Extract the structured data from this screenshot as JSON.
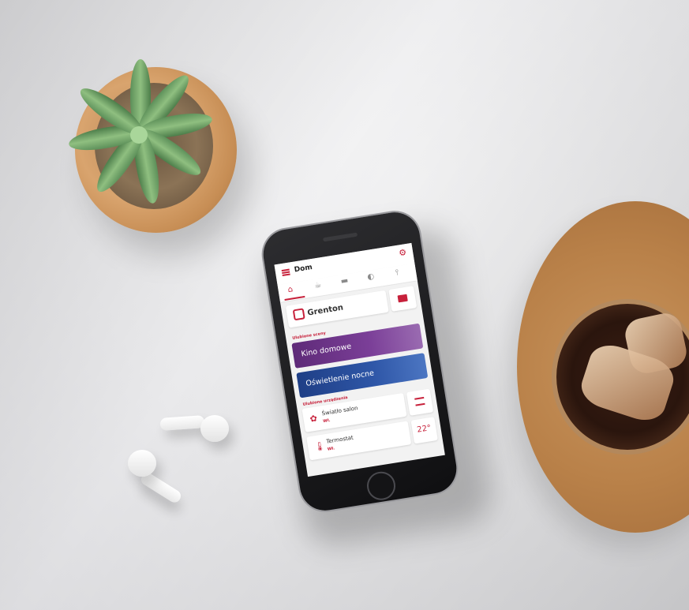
{
  "app": {
    "title": "Dom",
    "tabs": [
      "home-icon",
      "scenes-icon",
      "bed-icon",
      "devices-icon",
      "thermometer-icon"
    ],
    "brand": "Grenton",
    "favorite_scenes_label": "Ulubione sceny",
    "scenes": [
      {
        "label": "Kino domowe",
        "color": "#7b3f98"
      },
      {
        "label": "Oświetlenie nocne",
        "color": "#2f57a8"
      }
    ],
    "favorite_devices_label": "Ulubione urządzenia",
    "devices": [
      {
        "name": "Światło salon",
        "state": "Wł."
      },
      {
        "name": "Termostat",
        "state": "Wł.",
        "value": "22°"
      }
    ],
    "accent_color": "#c7213b"
  }
}
